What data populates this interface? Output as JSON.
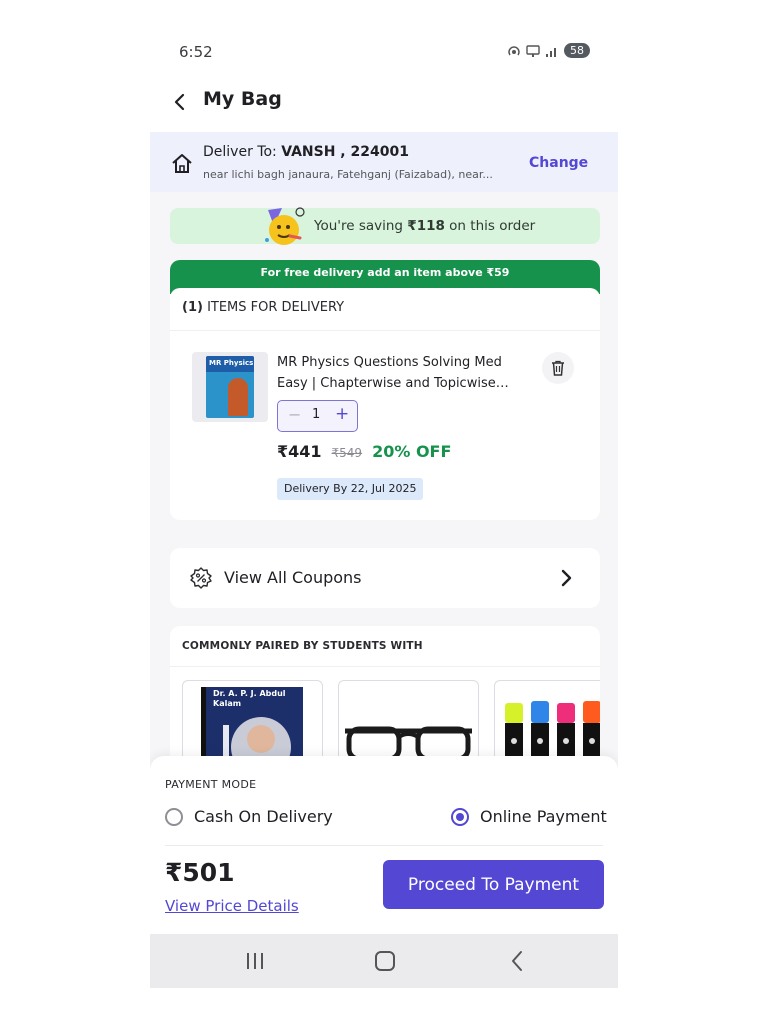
{
  "status_bar": {
    "time": "6:52",
    "battery": "58"
  },
  "header": {
    "title": "My Bag"
  },
  "address": {
    "prefix": "Deliver To: ",
    "name_pin": "VANSH , 224001",
    "line": "near lichi bagh janaura, Fatehganj (Faizabad), near...",
    "change_label": "Change"
  },
  "saving": {
    "prefix": "You're saving ",
    "amount": "₹118",
    "suffix": " on this order"
  },
  "free_delivery": {
    "text": "For free delivery add an item above ₹59"
  },
  "items": {
    "count": "(1)",
    "heading": " ITEMS FOR DELIVERY",
    "product": {
      "cover_label": "MR Physics",
      "title": "MR Physics Questions Solving Med Easy | Chapterwise and Topicwise Questions",
      "quantity": "1",
      "price": "₹441",
      "mrp": "₹549",
      "discount": "20% OFF",
      "delivery": "Delivery By 22, Jul 2025"
    }
  },
  "coupons": {
    "label": "View All Coupons"
  },
  "paired": {
    "heading": "COMMONLY PAIRED BY STUDENTS WITH",
    "items": [
      {
        "cover_text": "Dr. A. P. J. Abdul Kalam"
      },
      {
        "cover_text": ""
      },
      {
        "cover_text": ""
      }
    ]
  },
  "payment": {
    "heading": "PAYMENT MODE",
    "options": [
      {
        "label": "Cash On Delivery",
        "selected": false
      },
      {
        "label": "Online Payment",
        "selected": true
      }
    ],
    "total": "₹501",
    "view_details": "View Price Details",
    "proceed_label": "Proceed To Payment"
  },
  "colors": {
    "accent": "#5347d4",
    "success": "#17924d",
    "saving_bg": "#d9f4dd",
    "address_bg": "#eef0fb"
  },
  "icons": [
    "back-arrow-icon",
    "home-icon",
    "party-emoji-icon",
    "delete-icon",
    "coupon-icon",
    "chevron-right-icon",
    "recents-icon",
    "home-nav-icon",
    "back-nav-icon"
  ]
}
